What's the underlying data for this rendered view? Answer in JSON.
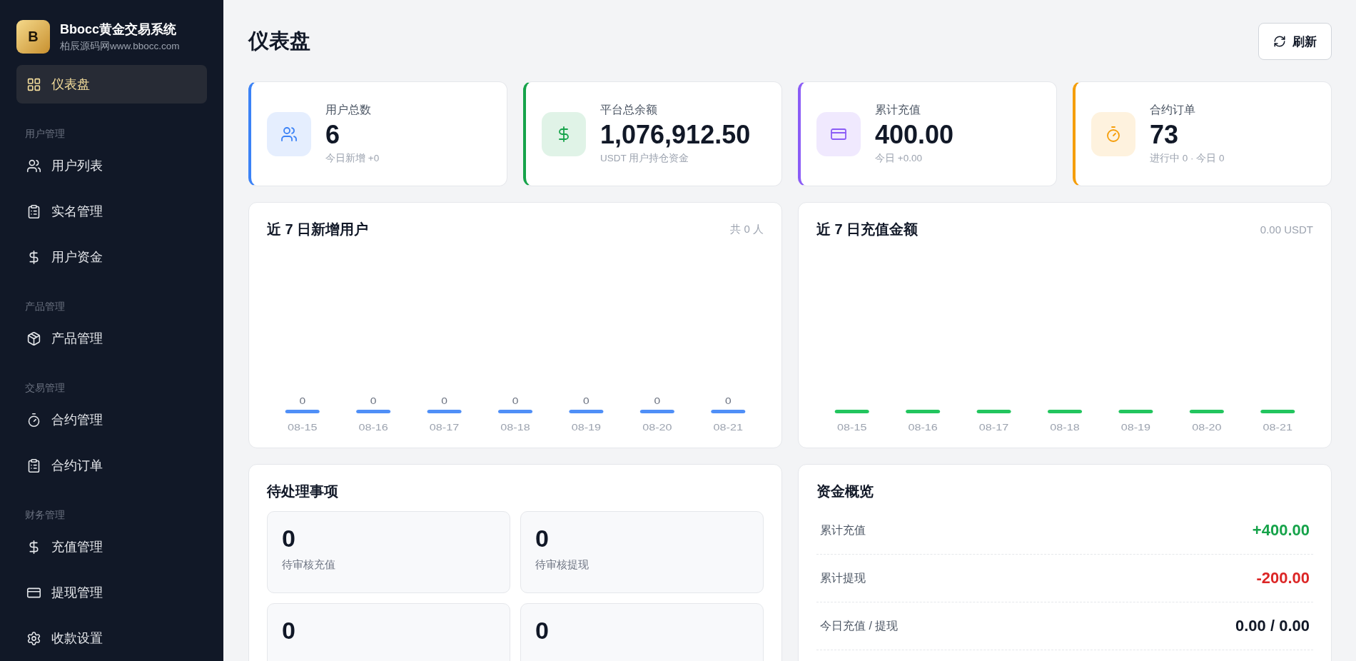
{
  "brand": {
    "logo_letter": "B",
    "title": "Bbocc黄金交易系统",
    "subtitle": "柏辰源码网www.bbocc.com"
  },
  "sidebar": {
    "groups": [
      {
        "items": [
          {
            "label": "仪表盘",
            "selected": true
          }
        ]
      },
      {
        "header": "用户管理",
        "items": [
          {
            "label": "用户列表",
            "selected": false
          },
          {
            "label": "实名管理",
            "selected": false
          },
          {
            "label": "用户资金",
            "selected": false
          }
        ]
      },
      {
        "header": "产品管理",
        "items": [
          {
            "label": "产品管理",
            "selected": false
          }
        ]
      },
      {
        "header": "交易管理",
        "items": [
          {
            "label": "合约管理",
            "selected": false
          },
          {
            "label": "合约订单",
            "selected": false
          }
        ]
      },
      {
        "header": "财务管理",
        "items": [
          {
            "label": "充值管理",
            "selected": false
          },
          {
            "label": "提现管理",
            "selected": false
          },
          {
            "label": "收款设置",
            "selected": false
          }
        ]
      }
    ]
  },
  "page": {
    "title": "仪表盘",
    "refresh_button": "刷新"
  },
  "stats": [
    {
      "label": "用户总数",
      "value": "6",
      "note": "今日新增 +0",
      "color": "#3b82f6"
    },
    {
      "label": "平台总余额",
      "value": "1,076,912.50",
      "note": "USDT 用户持仓资金",
      "color": "#16a34a"
    },
    {
      "label": "累计充值",
      "value": "400.00",
      "note": "今日 +0.00",
      "color": "#8b5cf6"
    },
    {
      "label": "合约订单",
      "value": "73",
      "note": "进行中 0 · 今日 0",
      "color": "#f59e0b"
    }
  ],
  "charts": [
    {
      "title": "近 7 日新增用户",
      "summary": "共 0 人",
      "color": "#4f8ff7",
      "bars": [
        {
          "date": "08-15",
          "value": "0"
        },
        {
          "date": "08-16",
          "value": "0"
        },
        {
          "date": "08-17",
          "value": "0"
        },
        {
          "date": "08-18",
          "value": "0"
        },
        {
          "date": "08-19",
          "value": "0"
        },
        {
          "date": "08-20",
          "value": "0"
        },
        {
          "date": "08-21",
          "value": "0"
        }
      ]
    },
    {
      "title": "近 7 日充值金额",
      "summary": "0.00 USDT",
      "color": "#22c55e",
      "bars": [
        {
          "date": "08-15"
        },
        {
          "date": "08-16"
        },
        {
          "date": "08-17"
        },
        {
          "date": "08-18"
        },
        {
          "date": "08-19"
        },
        {
          "date": "08-20"
        },
        {
          "date": "08-21"
        }
      ]
    }
  ],
  "pending": {
    "title": "待处理事项",
    "tiles": [
      {
        "value": "0",
        "label": "待审核充值"
      },
      {
        "value": "0",
        "label": "待审核提现"
      },
      {
        "value": "0"
      },
      {
        "value": "0"
      }
    ]
  },
  "funds": {
    "title": "资金概览",
    "rows": [
      {
        "label": "累计充值",
        "value": "+400.00",
        "color": "#16a34a"
      },
      {
        "label": "累计提现",
        "value": "-200.00",
        "color": "#dc2626"
      },
      {
        "label": "今日充值 / 提现",
        "value": "0.00 / 0.00",
        "color": "#111827"
      }
    ]
  }
}
